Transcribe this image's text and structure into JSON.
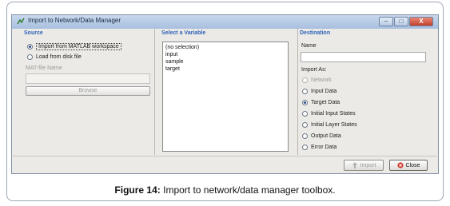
{
  "window": {
    "title": "Import to Network/Data Manager",
    "buttons": {
      "minimize": "–",
      "maximize": "□",
      "close": "X"
    }
  },
  "source": {
    "title": "Source",
    "options": [
      {
        "label": "Import from MATLAB workspace",
        "selected": true
      },
      {
        "label": "Load from disk file",
        "selected": false
      }
    ],
    "mat_file_label": "MAT-file Name",
    "mat_file_value": "",
    "browse_label": "Browse"
  },
  "select_variable": {
    "title": "Select a Variable",
    "items": [
      "(no selection)",
      "input",
      "sample",
      "target"
    ]
  },
  "destination": {
    "title": "Destination",
    "name_label": "Name",
    "name_value": "",
    "import_as_label": "Import As:",
    "options": [
      {
        "label": "Network",
        "selected": false,
        "disabled": true
      },
      {
        "label": "Input Data",
        "selected": false,
        "disabled": false
      },
      {
        "label": "Target Data",
        "selected": true,
        "disabled": false
      },
      {
        "label": "Initial Input States",
        "selected": false,
        "disabled": false
      },
      {
        "label": "Initial Layer States",
        "selected": false,
        "disabled": false
      },
      {
        "label": "Output Data",
        "selected": false,
        "disabled": false
      },
      {
        "label": "Error Data",
        "selected": false,
        "disabled": false
      }
    ]
  },
  "footer": {
    "import_label": "Import",
    "close_label": "Close"
  },
  "caption": {
    "figure": "Figure 14:",
    "text": "Import to network/data manager toolbox."
  }
}
